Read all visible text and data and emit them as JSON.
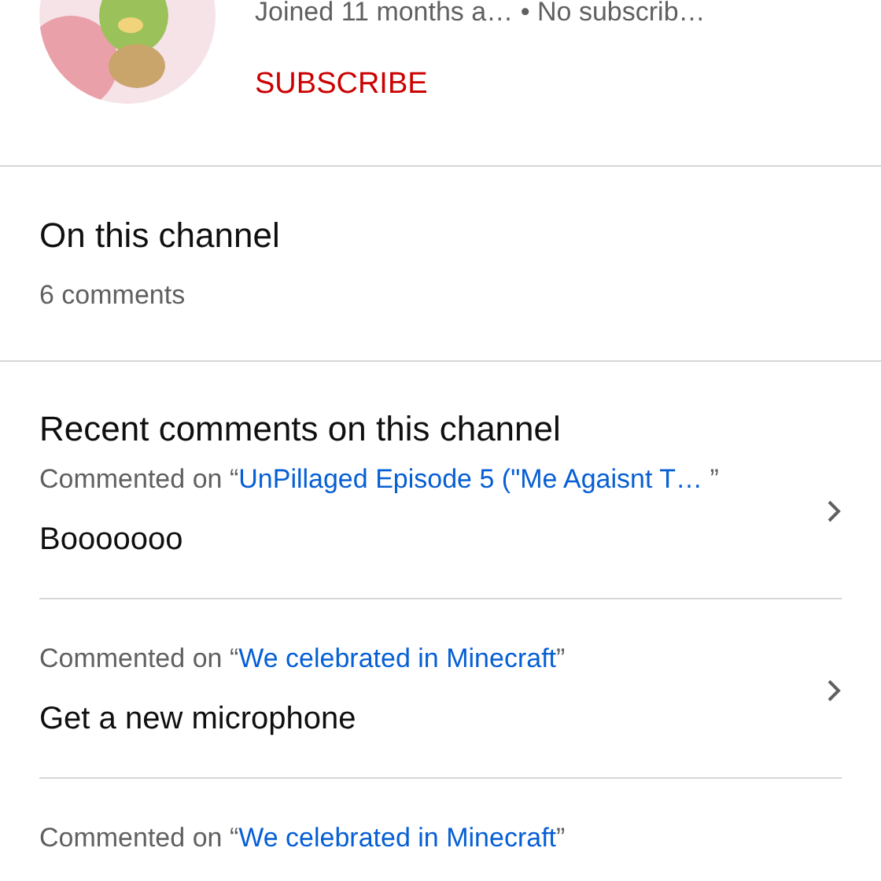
{
  "channel": {
    "info": "Joined 11 months a… • No subscrib…",
    "subscribe": "SUBSCRIBE"
  },
  "about": {
    "title": "On this channel",
    "count": "6 comments"
  },
  "recent": {
    "title": "Recent comments on this channel",
    "comments": [
      {
        "prefix": "Commented on “",
        "video": "UnPillaged Episode 5 (\"Me Agaisnt T…",
        "suffix": " ”",
        "text": "Booooooo"
      },
      {
        "prefix": "Commented on “",
        "video": "We celebrated in Minecraft",
        "suffix": "”",
        "text": "Get a new microphone"
      },
      {
        "prefix": "Commented on “",
        "video": "We celebrated in Minecraft",
        "suffix": "”"
      }
    ]
  }
}
